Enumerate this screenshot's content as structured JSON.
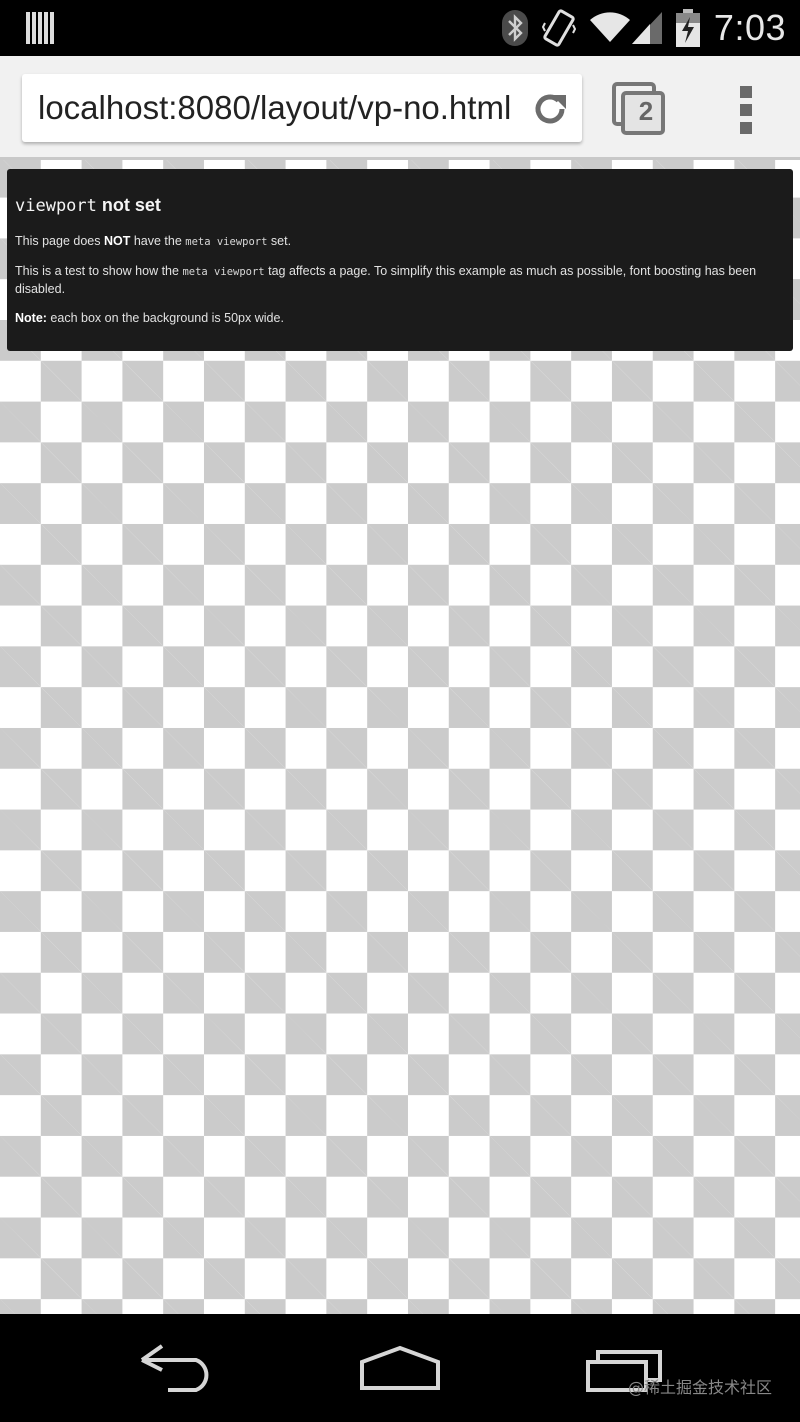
{
  "status_bar": {
    "time": "7:03",
    "icons": [
      "barcode-icon",
      "bluetooth-icon",
      "vibrate-icon",
      "wifi-icon",
      "signal-icon",
      "battery-charging-icon"
    ]
  },
  "toolbar": {
    "url": "localhost:8080/layout/vp-no.html",
    "tab_count": "2",
    "icons": [
      "reload-icon",
      "tabs-icon",
      "menu-icon"
    ]
  },
  "content": {
    "title_code": "viewport",
    "title_rest": " not set",
    "p1_a": "This page does ",
    "p1_b": "NOT",
    "p1_c": " have the ",
    "p1_code": "meta viewport",
    "p1_d": " set.",
    "p2_a": "This is a test to show how the ",
    "p2_code": "meta viewport",
    "p2_b": " tag affects a page. To simplify this example as much as possible, font boosting has been disabled.",
    "p3_label": "Note:",
    "p3_text": " each box on the background is 50px wide.",
    "colors": {
      "checker_dark": "#cbcbcb",
      "checker_light": "#ffffff",
      "panel": "#1b1b1b"
    }
  },
  "nav_bar": {
    "icons": [
      "back-icon",
      "home-icon",
      "recent-apps-icon"
    ],
    "watermark": "@稀土掘金技术社区"
  }
}
